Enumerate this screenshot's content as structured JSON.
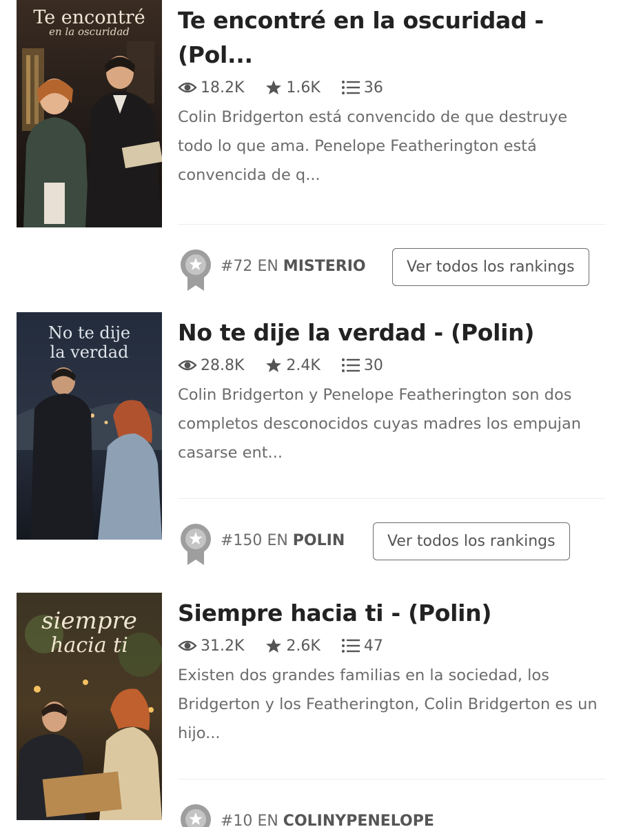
{
  "stories": [
    {
      "title": "Te encontré en la oscuridad - (Pol...",
      "cover_text_1": "Te encontré",
      "cover_text_2": "en la oscuridad",
      "reads": "18.2K",
      "votes": "1.6K",
      "parts": "36",
      "description": "Colin Bridgerton está convencido de que destruye todo lo que ama. Penelope Featherington está convencida de q...",
      "rank_number": "#72",
      "rank_in": "EN",
      "rank_category": "MISTERIO",
      "rankings_button": "Ver todos los rankings"
    },
    {
      "title": "No te dije la verdad - (Polin)",
      "cover_text_1": "No te dije",
      "cover_text_2": "la verdad",
      "reads": "28.8K",
      "votes": "2.4K",
      "parts": "30",
      "description": "Colin Bridgerton y Penelope Featherington son dos completos desconocidos cuyas madres los empujan casarse ent...",
      "rank_number": "#150",
      "rank_in": "EN",
      "rank_category": "POLIN",
      "rankings_button": "Ver todos los rankings"
    },
    {
      "title": "Siempre hacia ti - (Polin)",
      "cover_text_1": "siempre",
      "cover_text_2": "hacia ti",
      "reads": "31.2K",
      "votes": "2.6K",
      "parts": "47",
      "description": "Existen dos grandes familias en la sociedad, los Bridgerton y los Featherington, Colin Bridgerton es un hijo...",
      "rank_number": "#10",
      "rank_in": "EN",
      "rank_category": "COLINYPENELOPE"
    }
  ],
  "icons": {
    "reads": "eye-icon",
    "votes": "star-icon",
    "parts": "list-icon",
    "rank": "ribbon-medal-icon"
  },
  "colors": {
    "title": "#222222",
    "text_muted": "#6b6b6b",
    "medal": "#9e9e9e"
  }
}
